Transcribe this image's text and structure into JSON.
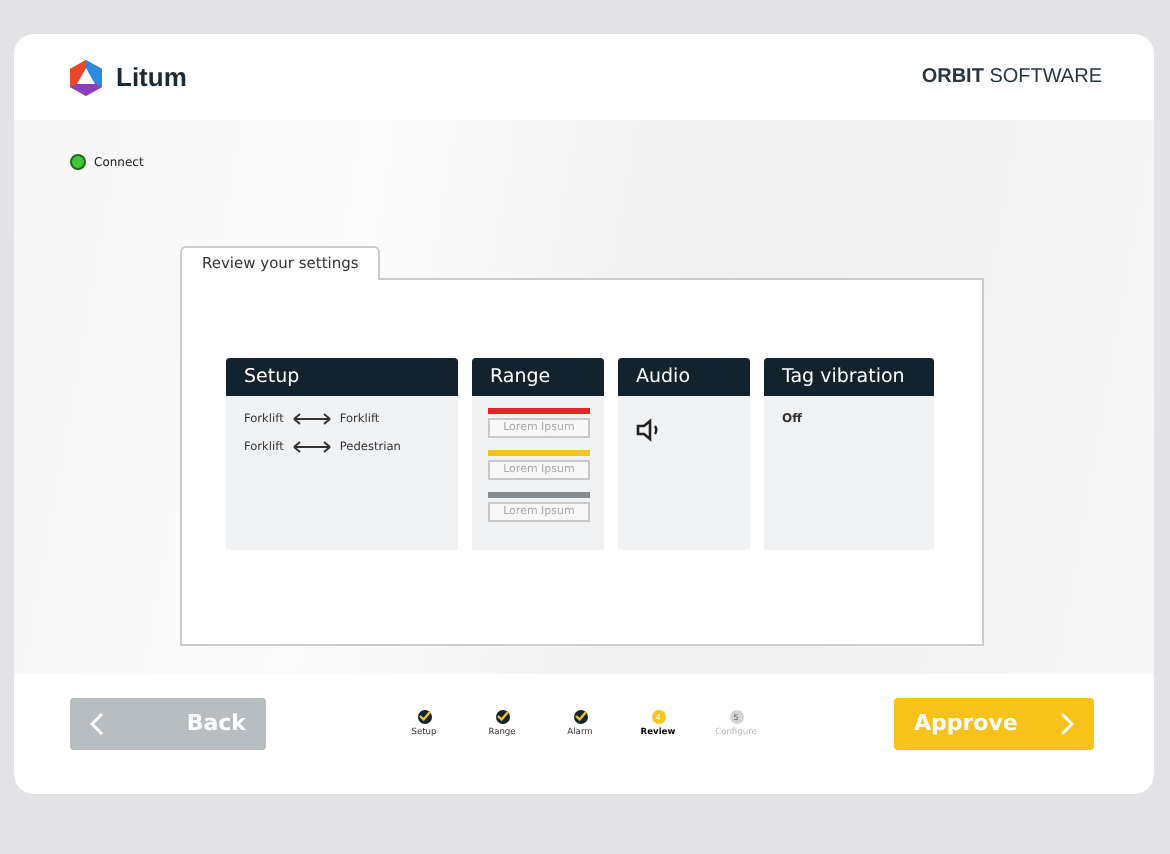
{
  "header": {
    "logo_text": "Litum",
    "product_bold": "ORBIT",
    "product_rest": "SOFTWARE"
  },
  "connection": {
    "label": "Connect",
    "color": "#3ec73a"
  },
  "panel": {
    "tab": "Review your settings",
    "cards": [
      {
        "kind": "pairs",
        "title": "Setup",
        "pairs": [
          {
            "from": "Forklift",
            "to": "Forklift"
          },
          {
            "from": "Forklift",
            "to": "Pedestrian"
          }
        ]
      },
      {
        "kind": "range",
        "title": "Range",
        "ranges": [
          {
            "color": "#e5232b",
            "label": "Lorem Ipsum"
          },
          {
            "color": "#f6c41c",
            "label": "Lorem Ipsum"
          },
          {
            "color": "#878c91",
            "label": "Lorem Ipsum"
          }
        ]
      },
      {
        "kind": "audio",
        "title": "Audio"
      },
      {
        "kind": "text",
        "title": "Tag vibration",
        "value": "Off"
      }
    ]
  },
  "footer": {
    "back": "Back",
    "approve": "Approve",
    "steps": [
      {
        "label": "Setup",
        "done": true,
        "current": false
      },
      {
        "label": "Range",
        "done": true,
        "current": false
      },
      {
        "label": "Alarm",
        "done": true,
        "current": false
      },
      {
        "label": "Review",
        "done": false,
        "current": true,
        "number": "4"
      },
      {
        "label": "Configure",
        "done": false,
        "current": false,
        "number": "5"
      }
    ]
  }
}
